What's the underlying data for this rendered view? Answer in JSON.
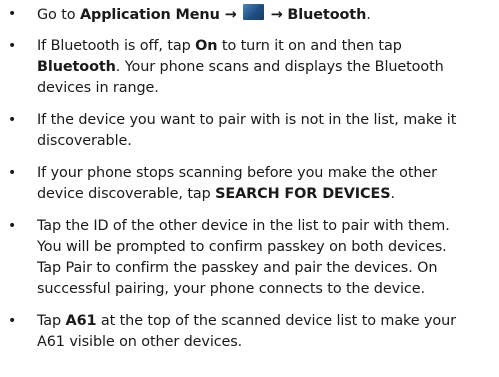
{
  "items": [
    {
      "bullet": "•",
      "lines": [
        {
          "pre": "Go to ",
          "bold1": "Application Menu →",
          "icon": "application-menu-icon",
          "bold2": "→ Bluetooth",
          "post": "."
        }
      ]
    },
    {
      "bullet": "•",
      "lines": [
        {
          "pre": "If Bluetooth is off, tap ",
          "bold": "On",
          "post": " to turn it on and then tap"
        },
        {
          "pre": "",
          "bold": "Bluetooth",
          "post": ". Your phone scans and displays the Bluetooth"
        },
        {
          "text": "devices in range."
        }
      ]
    },
    {
      "bullet": "•",
      "lines": [
        {
          "text": "If the device you want to pair with is not in the list, make it"
        },
        {
          "text": "discoverable."
        }
      ]
    },
    {
      "bullet": "•",
      "lines": [
        {
          "text": "If your phone stops scanning before you make the other"
        },
        {
          "pre": "device discoverable, tap ",
          "bold": "SEARCH FOR DEVICES",
          "post": "."
        }
      ]
    },
    {
      "bullet": "•",
      "lines": [
        {
          "text": "Tap the ID of the other device in the list to pair with them."
        },
        {
          "text": "You will be prompted to confirm passkey on both devices."
        },
        {
          "text": "Tap Pair to confirm the passkey and pair the devices. On"
        },
        {
          "text": "successful pairing, your phone connects to the device."
        }
      ]
    },
    {
      "bullet": "•",
      "lines": [
        {
          "pre": "Tap ",
          "bold": "A61",
          "post": " at the top of the scanned device list to make your"
        },
        {
          "text": "A61 visible on other devices."
        }
      ]
    }
  ]
}
